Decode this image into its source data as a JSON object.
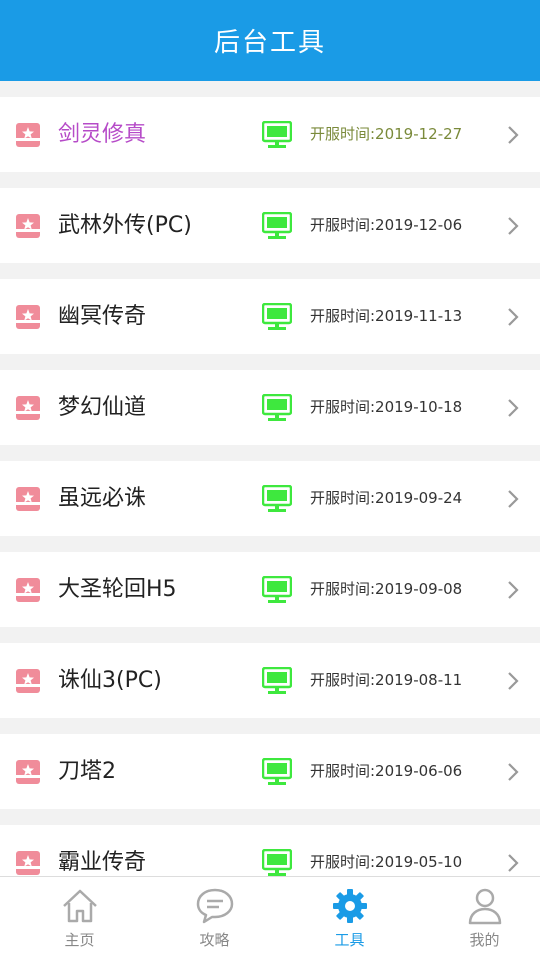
{
  "header": {
    "title": "后台工具"
  },
  "list": [
    {
      "name": "剑灵修真",
      "date": "开服时间:2019-12-27",
      "active": true
    },
    {
      "name": "武林外传(PC)",
      "date": "开服时间:2019-12-06",
      "active": false
    },
    {
      "name": "幽冥传奇",
      "date": "开服时间:2019-11-13",
      "active": false
    },
    {
      "name": "梦幻仙道",
      "date": "开服时间:2019-10-18",
      "active": false
    },
    {
      "name": "虽远必诛",
      "date": "开服时间:2019-09-24",
      "active": false
    },
    {
      "name": "大圣轮回H5",
      "date": "开服时间:2019-09-08",
      "active": false
    },
    {
      "name": "诛仙3(PC)",
      "date": "开服时间:2019-08-11",
      "active": false
    },
    {
      "name": "刀塔2",
      "date": "开服时间:2019-06-06",
      "active": false
    },
    {
      "name": "霸业传奇",
      "date": "开服时间:2019-05-10",
      "active": false
    }
  ],
  "icons": {
    "row_icon": "pink-star-tag-icon",
    "server_icon": "green-monitor-icon",
    "chevron": "chevron-right-icon"
  },
  "tabbar": {
    "tabs": [
      {
        "label": "主页",
        "icon": "home-icon",
        "active": false
      },
      {
        "label": "攻略",
        "icon": "chat-bubble-icon",
        "active": false
      },
      {
        "label": "工具",
        "icon": "gear-icon",
        "active": true
      },
      {
        "label": "我的",
        "icon": "user-icon",
        "active": false
      }
    ]
  },
  "colors": {
    "header_bg": "#1a9be6",
    "active_tab": "#1a9be6",
    "highlight_name": "#b64bc8",
    "highlight_date": "#7a8a3a",
    "server_icon": "#3ee83e",
    "row_icon": "#f08c9a"
  }
}
